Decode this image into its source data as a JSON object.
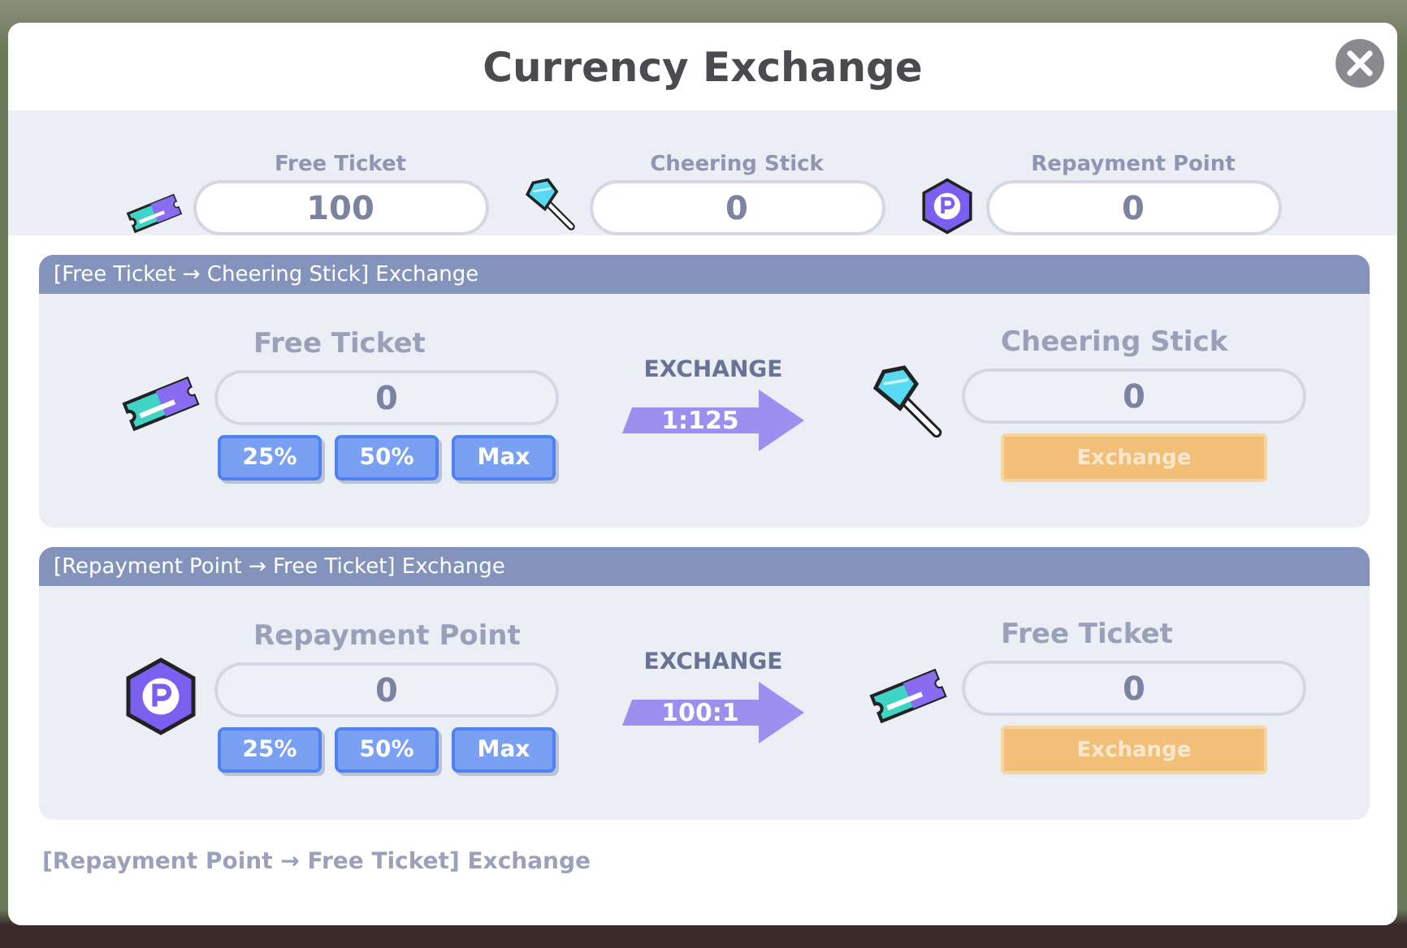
{
  "window": {
    "title": "Currency Exchange"
  },
  "balances": [
    {
      "kind": "ticket",
      "label": "Free Ticket",
      "value": "100"
    },
    {
      "kind": "stick",
      "label": "Cheering Stick",
      "value": "0"
    },
    {
      "kind": "point",
      "label": "Repayment Point",
      "value": "0"
    }
  ],
  "exchanges": [
    {
      "title": "[Free Ticket → Cheering Stick] Exchange",
      "from": {
        "kind": "ticket",
        "label": "Free Ticket",
        "value": "0"
      },
      "presets": [
        "25%",
        "50%",
        "Max"
      ],
      "arrow_label": "EXCHANGE",
      "rate": "1:125",
      "to": {
        "kind": "stick",
        "label": "Cheering Stick",
        "value": "0"
      },
      "button": {
        "label": "Exchange",
        "disabled": true
      }
    },
    {
      "title": "[Repayment Point → Free Ticket] Exchange",
      "from": {
        "kind": "point",
        "label": "Repayment Point",
        "value": "0"
      },
      "presets": [
        "25%",
        "50%",
        "Max"
      ],
      "arrow_label": "EXCHANGE",
      "rate": "100:1",
      "to": {
        "kind": "ticket",
        "label": "Free Ticket",
        "value": "0"
      },
      "button": {
        "label": "Exchange",
        "disabled": true
      }
    }
  ],
  "footer": "[Repayment Point → Free Ticket] Exchange"
}
